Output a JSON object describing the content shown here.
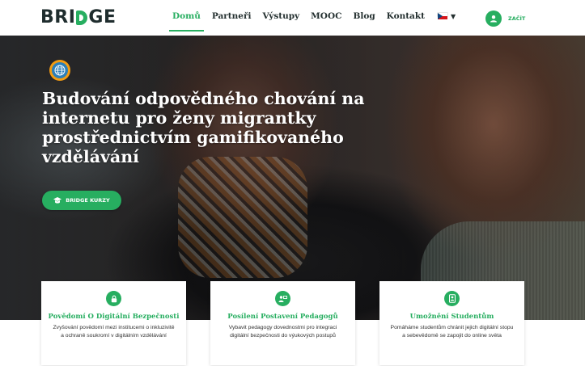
{
  "brand": {
    "logo_left": "BRI",
    "logo_right": "GE"
  },
  "nav": {
    "items": [
      {
        "label": "Domů",
        "active": true
      },
      {
        "label": "Partneři"
      },
      {
        "label": "Výstupy"
      },
      {
        "label": "MOOC"
      },
      {
        "label": "Blog"
      },
      {
        "label": "Kontakt"
      }
    ],
    "language_icon": "czech-flag-icon",
    "start_label": "ZAČÍT"
  },
  "hero": {
    "headline": "Budování odpovědného chování na internetu pro ženy migrantky prostřednictvím gamifikovaného vzdělávání",
    "cta_label": "BRIDGE KURZY"
  },
  "cards": [
    {
      "icon": "lock-icon",
      "title": "Povědomí O Digitální Bezpečnosti",
      "text": "Zvyšování povědomí mezi institucemi o inkluzivitě a ochraně soukromí v digitálním vzdělávání"
    },
    {
      "icon": "teacher-icon",
      "title": "Posílení Postavení Pedagogů",
      "text": "Vybavit pedagogy dovednostmi pro integraci digitální bezpečnosti do výukových postupů"
    },
    {
      "icon": "student-badge-icon",
      "title": "Umožnění Studentům",
      "text": "Pomáháme studentům chránit jejich digitální stopu a sebevědomě se zapojit do online světa"
    }
  ],
  "colors": {
    "accent": "#27ae60",
    "dark_text": "#1f2d2e",
    "badge_orange": "#f39c12"
  }
}
